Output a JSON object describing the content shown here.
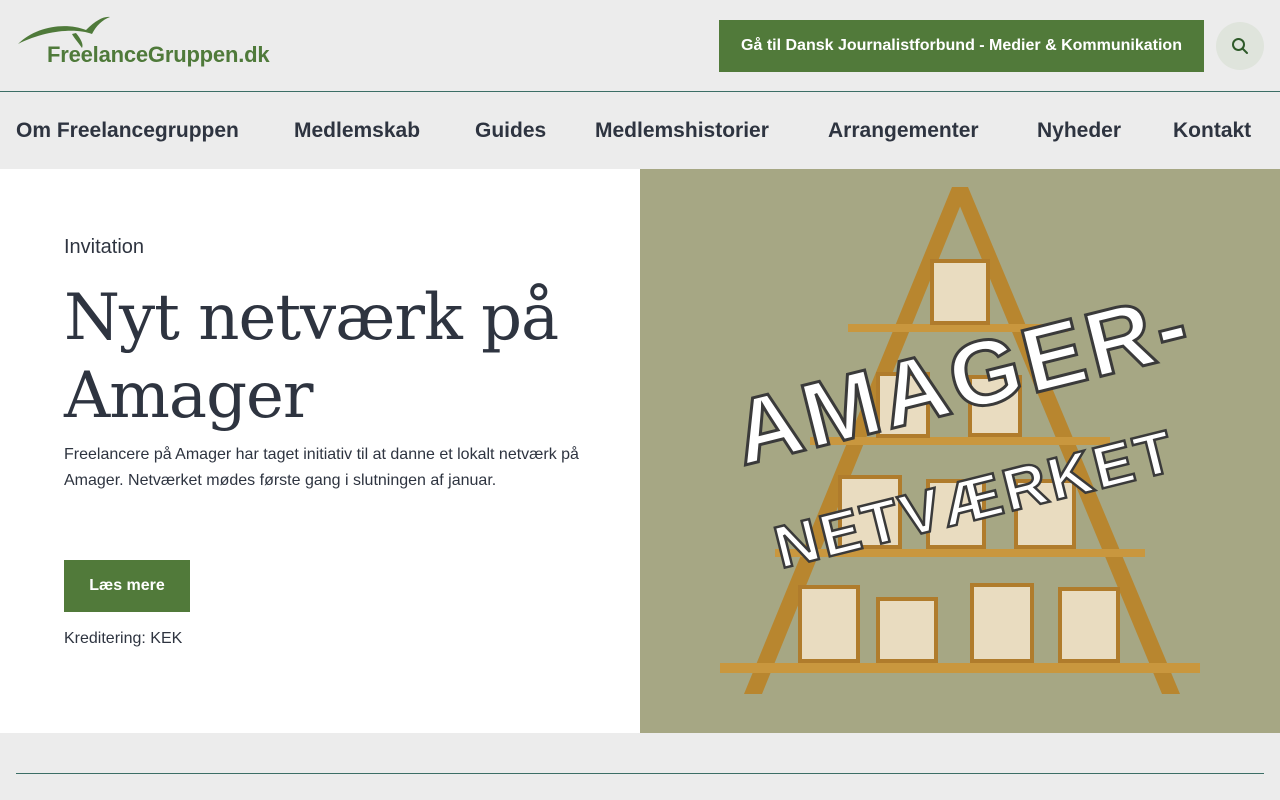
{
  "header": {
    "logo_text": "FreelanceGruppen.dk",
    "cta_label": "Gå til Dansk Journalistforbund - Medier & Kommunikation",
    "search_icon": "search-icon"
  },
  "nav": {
    "items": [
      {
        "label": "Om Freelancegruppen"
      },
      {
        "label": "Medlemskab"
      },
      {
        "label": "Guides"
      },
      {
        "label": "Medlemshistorier"
      },
      {
        "label": "Arrangementer"
      },
      {
        "label": "Nyheder"
      },
      {
        "label": "Kontakt"
      }
    ]
  },
  "hero": {
    "kicker": "Invitation",
    "title": "Nyt netværk på Amager",
    "lead": "Freelancere på Amager har taget initiativ til at danne et lokalt netværk på Amager. Netværket mødes første gang i slutningen af januar.",
    "button_label": "Læs mere",
    "credit": "Kreditering: KEK",
    "image_text_line1": "AMAGER-",
    "image_text_line2": "NETVÆRKET"
  },
  "colors": {
    "accent_green": "#517a3a",
    "background": "#ececec",
    "text_dark": "#2e3440",
    "rule": "#3c6e66",
    "image_bg": "#a6a784"
  }
}
